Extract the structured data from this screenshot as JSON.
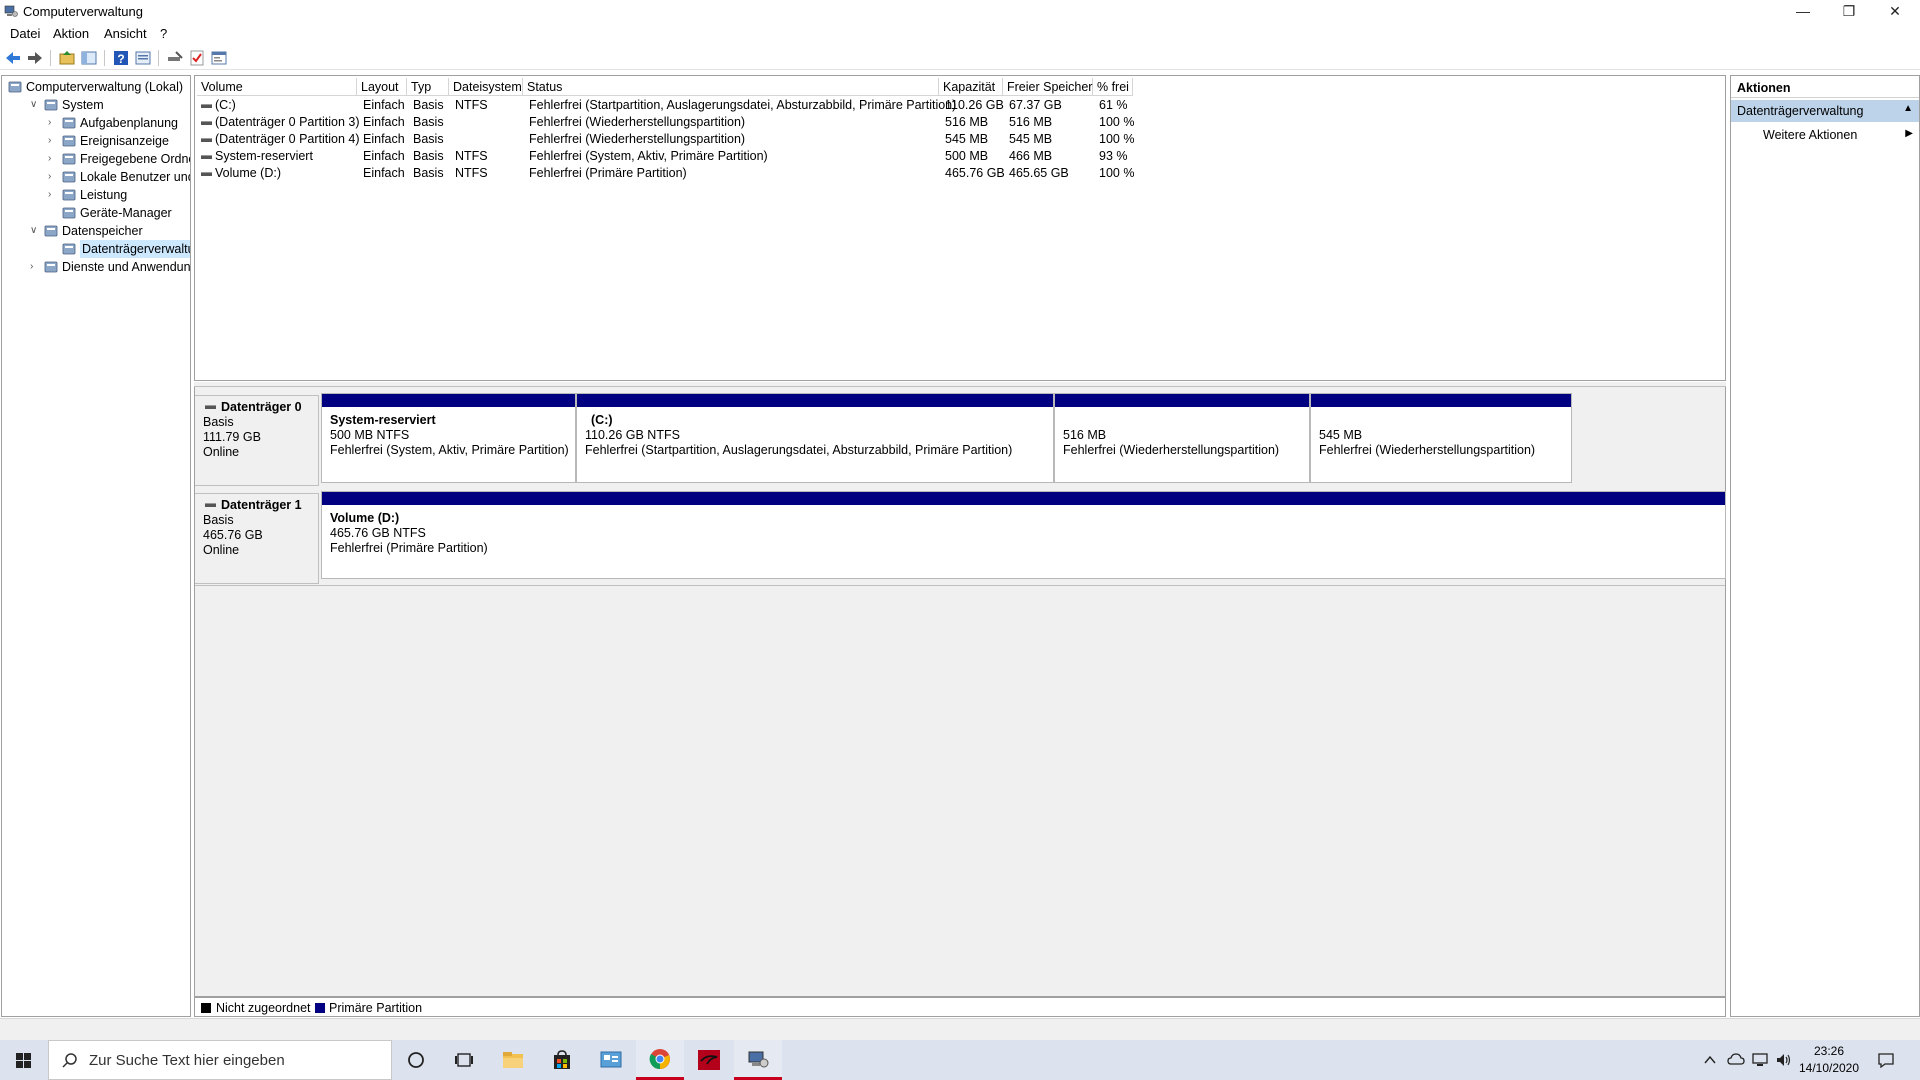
{
  "window": {
    "title": "Computerverwaltung",
    "controls": {
      "minimize": "—",
      "restore": "❐",
      "close": "✕"
    }
  },
  "menu": [
    "Datei",
    "Aktion",
    "Ansicht",
    "?"
  ],
  "tree": {
    "nodes": [
      {
        "label": "Computerverwaltung (Lokal)",
        "icon": "computer-management-icon",
        "level": 0,
        "expander": ""
      },
      {
        "label": "System",
        "icon": "system-tools-icon",
        "level": 1,
        "expander": "∨"
      },
      {
        "label": "Aufgabenplanung",
        "icon": "task-scheduler-icon",
        "level": 2,
        "expander": "›"
      },
      {
        "label": "Ereignisanzeige",
        "icon": "event-viewer-icon",
        "level": 2,
        "expander": "›"
      },
      {
        "label": "Freigegebene Ordner",
        "icon": "shared-folders-icon",
        "level": 2,
        "expander": "›"
      },
      {
        "label": "Lokale Benutzer und Gruppen",
        "icon": "local-users-icon",
        "level": 2,
        "expander": "›"
      },
      {
        "label": "Leistung",
        "icon": "performance-icon",
        "level": 2,
        "expander": "›"
      },
      {
        "label": "Geräte-Manager",
        "icon": "device-manager-icon",
        "level": 2,
        "expander": ""
      },
      {
        "label": "Datenspeicher",
        "icon": "storage-icon",
        "level": 1,
        "expander": "∨"
      },
      {
        "label": "Datenträgerverwaltung",
        "icon": "disk-management-icon",
        "level": 2,
        "expander": ""
      },
      {
        "label": "Dienste und Anwendungen",
        "icon": "services-applications-icon",
        "level": 1,
        "expander": "›"
      }
    ],
    "selected_index": 9
  },
  "volume_table": {
    "columns": [
      "Volume",
      "Layout",
      "Typ",
      "Dateisystem",
      "Status",
      "Kapazität",
      "Freier Speicher",
      "% frei"
    ],
    "rows": [
      [
        "(C:)",
        "Einfach",
        "Basis",
        "NTFS",
        "Fehlerfrei (Startpartition, Auslagerungsdatei, Absturzabbild, Primäre Partition)",
        "110.26 GB",
        "67.37 GB",
        "61 %"
      ],
      [
        "(Datenträger 0 Partition 3)",
        "Einfach",
        "Basis",
        "",
        "Fehlerfrei (Wiederherstellungspartition)",
        "516 MB",
        "516 MB",
        "100 %"
      ],
      [
        "(Datenträger 0 Partition 4)",
        "Einfach",
        "Basis",
        "",
        "Fehlerfrei (Wiederherstellungspartition)",
        "545 MB",
        "545 MB",
        "100 %"
      ],
      [
        "System-reserviert",
        "Einfach",
        "Basis",
        "NTFS",
        "Fehlerfrei (System, Aktiv, Primäre Partition)",
        "500 MB",
        "466 MB",
        "93 %"
      ],
      [
        "Volume (D:)",
        "Einfach",
        "Basis",
        "NTFS",
        "Fehlerfrei (Primäre Partition)",
        "465.76 GB",
        "465.65 GB",
        "100 %"
      ]
    ]
  },
  "disks": [
    {
      "name": "Datenträger 0",
      "type": "Basis",
      "size": "111.79 GB",
      "state": "Online",
      "partitions": [
        {
          "name": "System-reserviert",
          "size": "500 MB NTFS",
          "status": "Fehlerfrei (System, Aktiv, Primäre Partition)"
        },
        {
          "name": "(C:)",
          "size": "110.26 GB NTFS",
          "status": "Fehlerfrei (Startpartition, Auslagerungsdatei, Absturzabbild, Primäre Partition)"
        },
        {
          "name": "",
          "size": "516 MB",
          "status": "Fehlerfrei (Wiederherstellungspartition)"
        },
        {
          "name": "",
          "size": "545 MB",
          "status": "Fehlerfrei (Wiederherstellungspartition)"
        }
      ]
    },
    {
      "name": "Datenträger 1",
      "type": "Basis",
      "size": "465.76 GB",
      "state": "Online",
      "partitions": [
        {
          "name": "Volume  (D:)",
          "size": "465.76 GB NTFS",
          "status": "Fehlerfrei (Primäre Partition)"
        }
      ]
    }
  ],
  "legend": [
    {
      "label": "Nicht zugeordnet",
      "color": "#000000"
    },
    {
      "label": "Primäre Partition",
      "color": "#000080"
    }
  ],
  "actions": {
    "header": "Aktionen",
    "section": "Datenträgerverwaltung",
    "more": "Weitere Aktionen"
  },
  "taskbar": {
    "search_placeholder": "Zur Suche Text hier eingeben",
    "time": "23:26",
    "date": "14/10/2020",
    "apps": [
      "cortana-icon",
      "task-view-icon",
      "file-explorer-icon",
      "store-icon",
      "control-panel-icon",
      "chrome-icon",
      "kali-app-icon",
      "computer-management-app-icon"
    ]
  },
  "colors": {
    "primary_partition": "#000080",
    "selection": "#cce8ff",
    "actions_header": "#bcd3ea"
  }
}
